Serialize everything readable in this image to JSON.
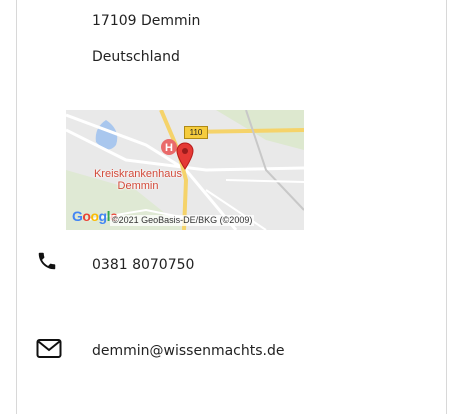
{
  "address": {
    "postal_city": "17109 Demmin",
    "country": "Deutschland"
  },
  "map": {
    "place_label": "Kreiskrankenhaus Demmin",
    "route_label": "110",
    "logo": "Google",
    "copyright": "©2021 GeoBasis-DE/BKG (©2009)",
    "logo_colors": [
      "#4285F4",
      "#EA4335",
      "#FBBC05",
      "#4285F4",
      "#34A853",
      "#EA4335"
    ],
    "marker_color": "#e53935"
  },
  "contact": {
    "phone": "0381 8070750",
    "email": "demmin@wissenmachts.de",
    "phone_icon": "phone-icon",
    "email_icon": "envelope-icon"
  }
}
